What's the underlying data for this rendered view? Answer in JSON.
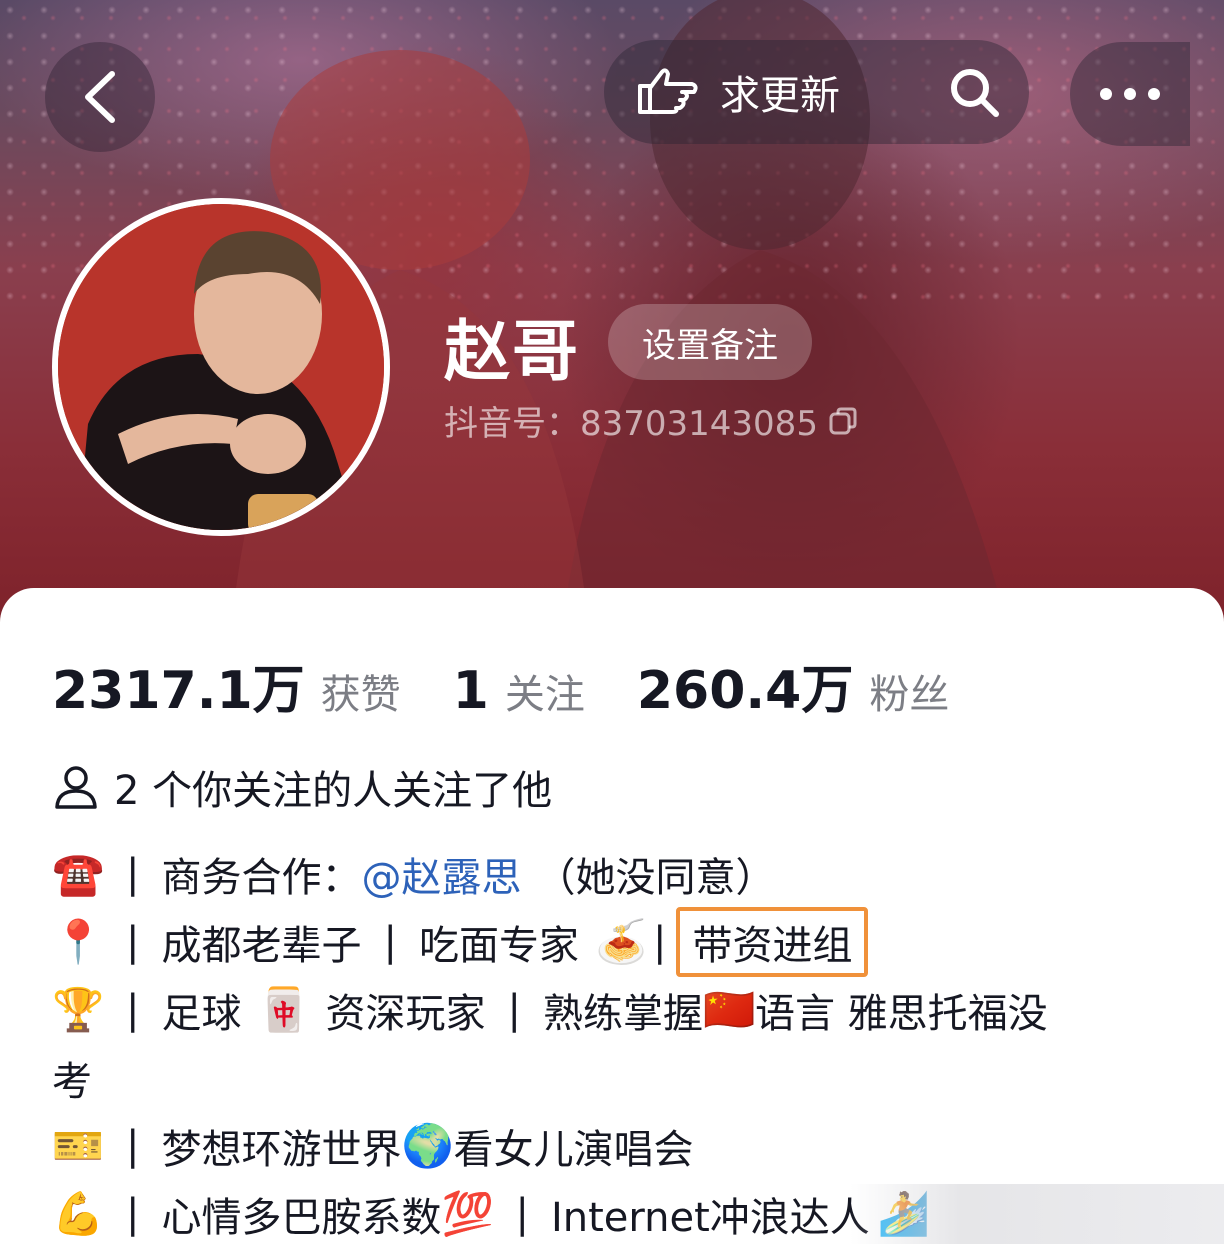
{
  "header": {
    "update_label": "求更新",
    "icons": {
      "back": "chevron-left-icon",
      "update": "hand-point-icon",
      "search": "search-icon",
      "more": "more-dots-icon",
      "copy": "copy-icon"
    }
  },
  "profile": {
    "name": "赵哥",
    "remark_button": "设置备注",
    "douyin_id": "抖音号：83703143085"
  },
  "stats": [
    {
      "value": "2317.1万",
      "label": "获赞"
    },
    {
      "value": "1",
      "label": "关注"
    },
    {
      "value": "260.4万",
      "label": "粉丝"
    }
  ],
  "mutual_follow": "2 个你关注的人关注了他",
  "bio": {
    "line1": {
      "emoji": "☎️",
      "text_a": "商务合作：",
      "mention": "@赵露思",
      "text_b": "（她没同意）"
    },
    "line2": {
      "emoji": "📍",
      "text_a": "成都老辈子",
      "text_b": "吃面专家",
      "food_emoji": "🍝",
      "highlight": "带资进组"
    },
    "line3": {
      "emoji": "🏆",
      "text_a": "足球",
      "mahjong_emoji": "🀄",
      "text_b": "资深玩家",
      "text_c": "熟练掌握",
      "flag_emoji": "🇨🇳",
      "text_d": "语言 雅思托福没",
      "text_e": "考"
    },
    "line4": {
      "emoji": "🎫",
      "text_a": "梦想环游世界",
      "globe_emoji": "🌍",
      "text_b": "看女儿演唱会"
    },
    "line5": {
      "emoji": "💪",
      "text_a": "心情多巴胺系数",
      "hundred_emoji": "💯",
      "text_b": "Internet冲浪达人",
      "surf_emoji": "🏄"
    },
    "separator": "|"
  },
  "colors": {
    "accent_mention": "#2d62b9",
    "highlight_box": "#f0913a",
    "banner": "#8a2e38"
  }
}
